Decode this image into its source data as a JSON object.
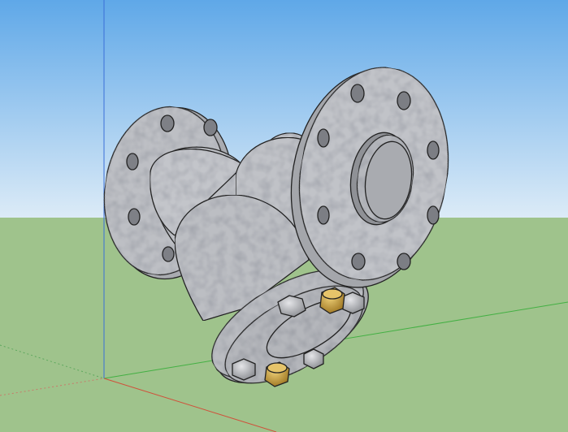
{
  "viewport": {
    "sky_top_color": "#5FA8E8",
    "sky_bottom_color": "#DCEBF7",
    "ground_color": "#9FC38C"
  },
  "axes": {
    "red_color": "#D0503A",
    "green_color": "#43B043",
    "blue_color": "#3A6FD8"
  },
  "model": {
    "name": "y-strainer",
    "body_color": "#B9BBC0",
    "edge_color": "#222222",
    "bolt_color": "#A8AAAE",
    "brass_plug_color": "#C9A13A"
  }
}
